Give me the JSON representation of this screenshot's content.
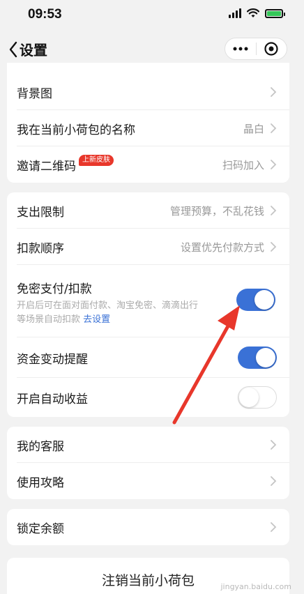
{
  "status_bar": {
    "time": "09:53"
  },
  "nav": {
    "title": "设置"
  },
  "group1": {
    "rows": [
      {
        "label": "背景图",
        "value": ""
      },
      {
        "label": "我在当前小荷包的名称",
        "value": "晶白"
      },
      {
        "label": "邀请二维码",
        "badge": "上新皮肤",
        "value": "扫码加入"
      }
    ]
  },
  "group2": {
    "spend_limit": {
      "label": "支出限制",
      "value": "管理预算，不乱花钱"
    },
    "deduct_order": {
      "label": "扣款顺序",
      "value": "设置优先付款方式"
    },
    "password_free": {
      "label": "免密支付/扣款",
      "desc_line1": "开启后可在面对面付款、淘宝免密、滴滴出行",
      "desc_line2": "等场景自动扣款",
      "link": "去设置",
      "enabled": true
    },
    "fund_alert": {
      "label": "资金变动提醒",
      "enabled": true
    },
    "auto_income": {
      "label": "开启自动收益",
      "enabled": false
    }
  },
  "group3": {
    "rows": [
      {
        "label": "我的客服"
      },
      {
        "label": "使用攻略"
      }
    ]
  },
  "group4": {
    "lock_balance": {
      "label": "锁定余额"
    }
  },
  "logout": {
    "label": "注销当前小荷包"
  },
  "watermark": {
    "line1": "jingyan.baidu.com"
  },
  "colors": {
    "toggle_on": "#3a71d6",
    "badge": "#e8372b",
    "annotation_arrow": "#e8372b"
  }
}
